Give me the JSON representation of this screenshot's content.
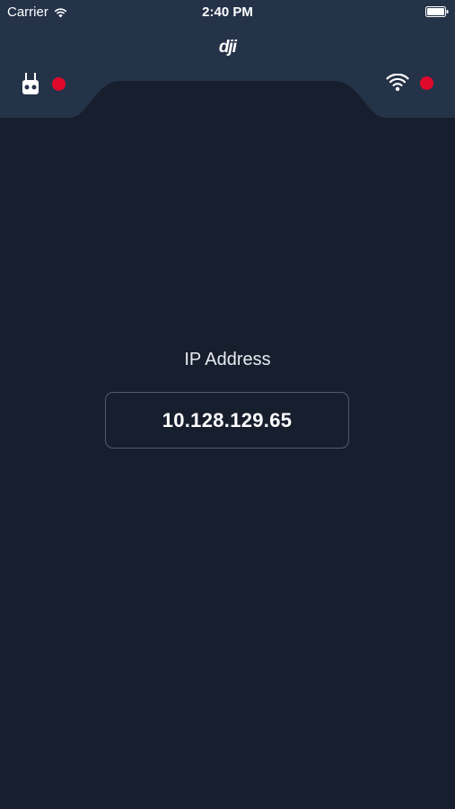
{
  "status_bar": {
    "carrier": "Carrier",
    "time": "2:40 PM",
    "icons": [
      "wifi-signal-icon",
      "battery-icon"
    ]
  },
  "header": {
    "logo_text": "dji",
    "remote_controller": {
      "icon": "remote-controller-icon",
      "status_color": "#e0092b"
    },
    "wifi": {
      "icon": "wifi-icon",
      "status_color": "#e0092b"
    }
  },
  "main": {
    "ip_label": "IP Address",
    "ip_value": "10.128.129.65"
  },
  "colors": {
    "background": "#171f2e",
    "header": "#253349",
    "status_dot": "#e0092b",
    "box_border": "#4e5a6e"
  }
}
